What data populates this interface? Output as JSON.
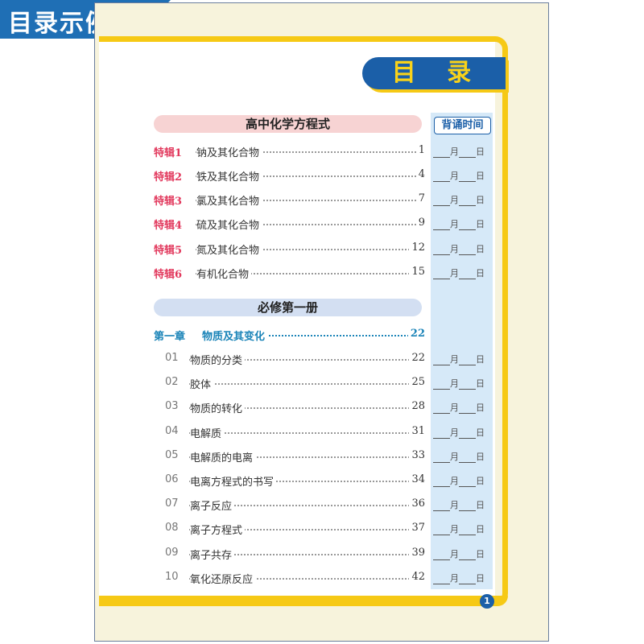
{
  "banner": {
    "text": "目录示例"
  },
  "page_title": "目 录",
  "review_header": "背诵时间",
  "date_parts": {
    "month": "月",
    "day": "日"
  },
  "section1": {
    "title": "高中化学方程式",
    "rows": [
      {
        "tag": "特辑1",
        "label": "钠及其化合物",
        "page": "1"
      },
      {
        "tag": "特辑2",
        "label": "铁及其化合物",
        "page": "4"
      },
      {
        "tag": "特辑3",
        "label": "氯及其化合物",
        "page": "7"
      },
      {
        "tag": "特辑4",
        "label": "硫及其化合物",
        "page": "9"
      },
      {
        "tag": "特辑5",
        "label": "氮及其化合物",
        "page": "12"
      },
      {
        "tag": "特辑6",
        "label": "有机化合物",
        "page": "15"
      }
    ]
  },
  "section2": {
    "title": "必修第一册",
    "chapter": {
      "tag": "第一章",
      "label": "物质及其变化",
      "page": "22"
    },
    "rows": [
      {
        "num": "01",
        "label": "物质的分类",
        "page": "22"
      },
      {
        "num": "02",
        "label": "胶体",
        "page": "25"
      },
      {
        "num": "03",
        "label": "物质的转化",
        "page": "28"
      },
      {
        "num": "04",
        "label": "电解质",
        "page": "31"
      },
      {
        "num": "05",
        "label": "电解质的电离",
        "page": "33"
      },
      {
        "num": "06",
        "label": "电离方程式的书写",
        "page": "34"
      },
      {
        "num": "07",
        "label": "离子反应",
        "page": "36"
      },
      {
        "num": "08",
        "label": "离子方程式",
        "page": "37"
      },
      {
        "num": "09",
        "label": "离子共存",
        "page": "39"
      },
      {
        "num": "10",
        "label": "氧化还原反应",
        "page": "42"
      }
    ]
  },
  "page_number": "1",
  "colors": {
    "brand_blue": "#1b5fa8",
    "accent_yellow": "#f6c915",
    "tag_pink": "#e23a5e",
    "chapter_blue": "#1b84b8"
  }
}
